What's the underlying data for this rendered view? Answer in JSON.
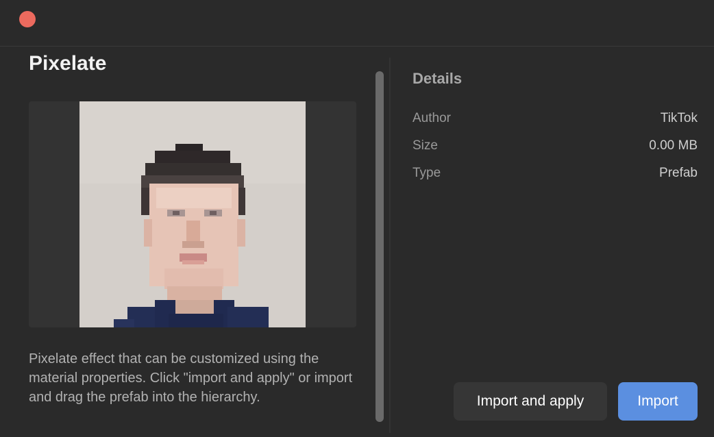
{
  "window": {
    "close_button": "close"
  },
  "effect": {
    "title": "Pixelate",
    "description": "Pixelate effect that can be customized using the material properties. Click \"import and apply\" or import and drag the prefab into the hierarchy."
  },
  "details": {
    "heading": "Details",
    "rows": [
      {
        "key": "Author",
        "value": "TikTok"
      },
      {
        "key": "Size",
        "value": "0.00 MB"
      },
      {
        "key": "Type",
        "value": "Prefab"
      }
    ]
  },
  "actions": {
    "import_and_apply_label": "Import and apply",
    "import_label": "Import"
  },
  "colors": {
    "background": "#2a2a2a",
    "close_dot": "#ec6a5e",
    "primary_button": "#5b8fe0",
    "secondary_button": "#363636"
  }
}
